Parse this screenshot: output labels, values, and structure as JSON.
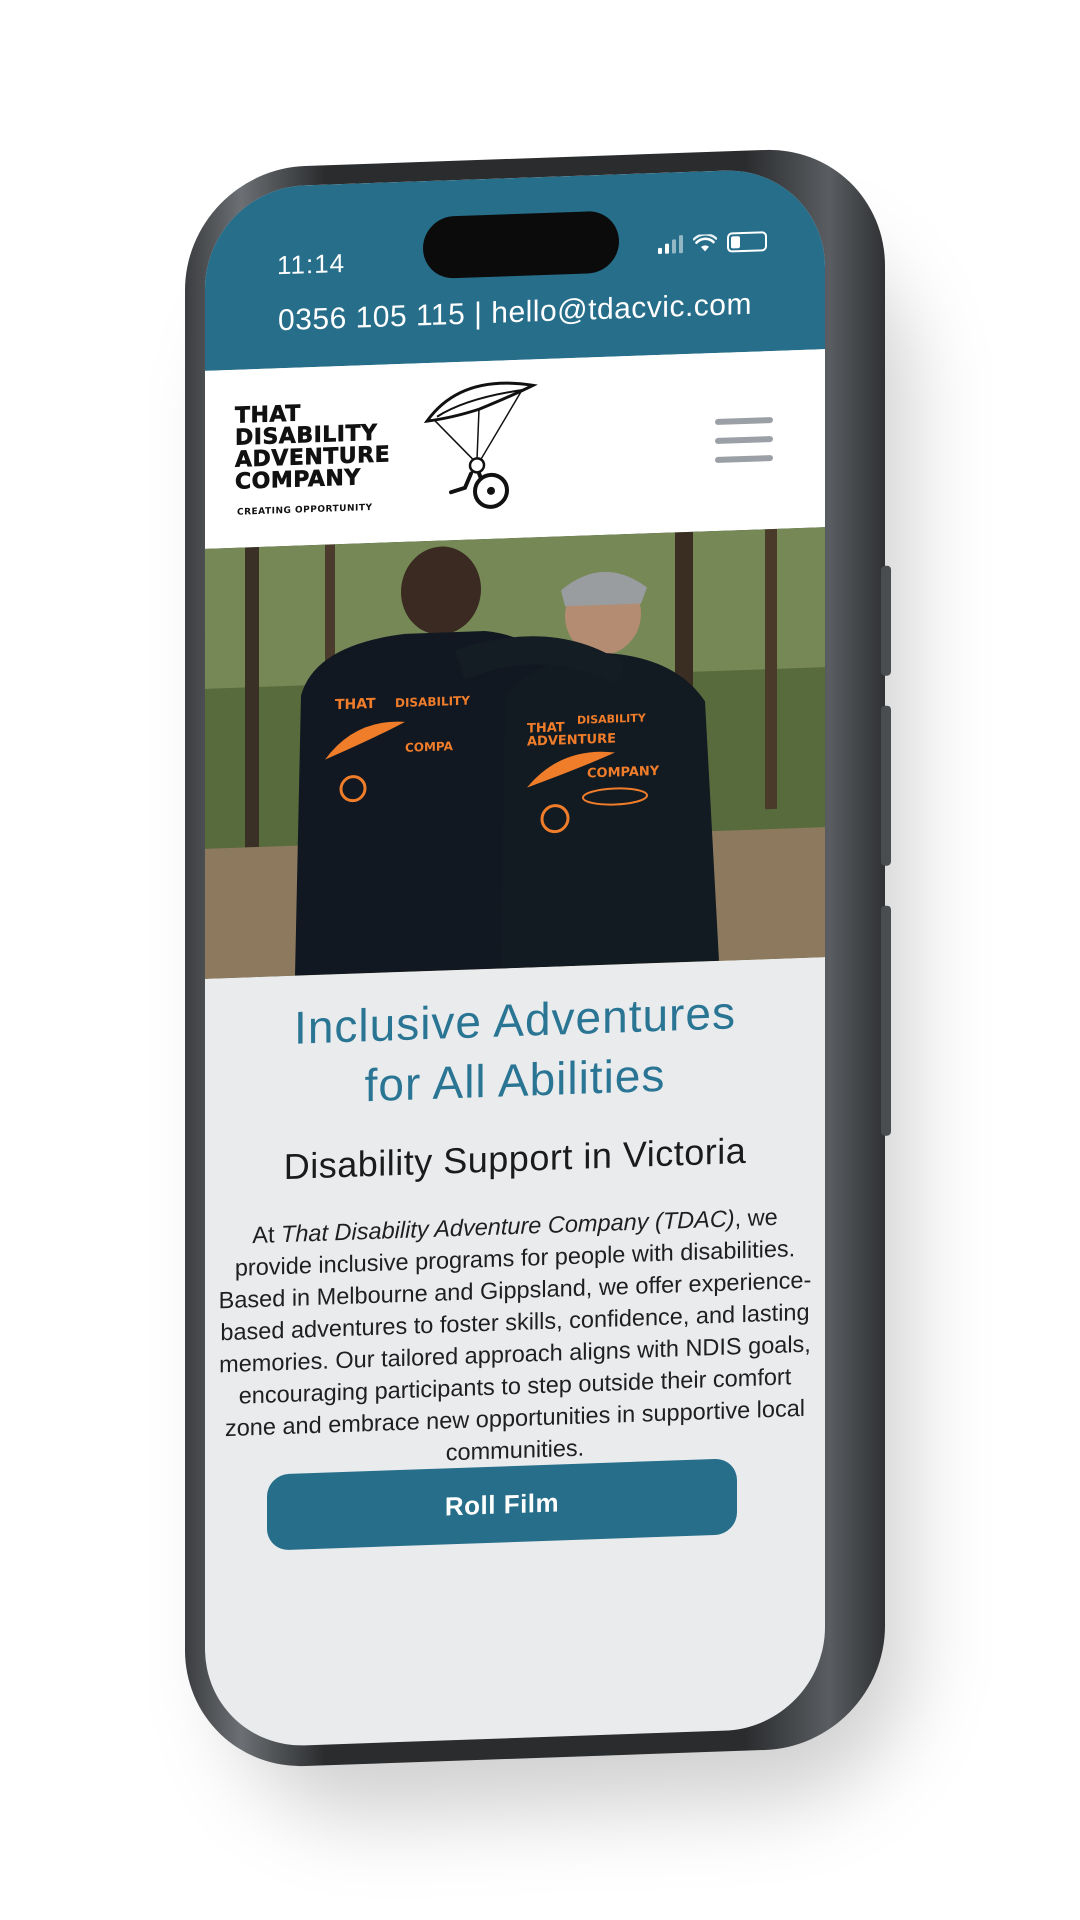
{
  "status_bar": {
    "time": "11:14"
  },
  "contact_bar": {
    "text": "0356 105 115 | hello@tdacvic.com"
  },
  "logo": {
    "lines": [
      "THAT",
      "DISABILITY",
      "ADVENTURE",
      "COMPANY"
    ],
    "tagline": "CREATING OPPORTUNITY",
    "icon": "paraglider-wheelchair-icon"
  },
  "header": {
    "menu_icon": "hamburger-menu-icon"
  },
  "hero": {
    "image_alt": "Two men in black TDAC t-shirts walking on a forest trail"
  },
  "main": {
    "headline_line1": "Inclusive Adventures",
    "headline_line2": "for All Abilities",
    "subheading": "Disability Support in Victoria",
    "body_prefix": "At ",
    "body_italic": "That Disability Adventure Company (TDAC)",
    "body_rest": ", we provide inclusive programs for people with disabilities. Based in Melbourne and Gippsland, we offer experience-based adventures to foster skills, confidence, and lasting memories. Our tailored approach aligns with NDIS goals, encouraging participants to step outside their comfort zone and embrace new opportunities in supportive local communities.",
    "cta_label": "Roll Film"
  },
  "colors": {
    "brand_teal": "#266e8a",
    "headline_teal": "#2a7594",
    "shirt_orange": "#f07d2a"
  }
}
